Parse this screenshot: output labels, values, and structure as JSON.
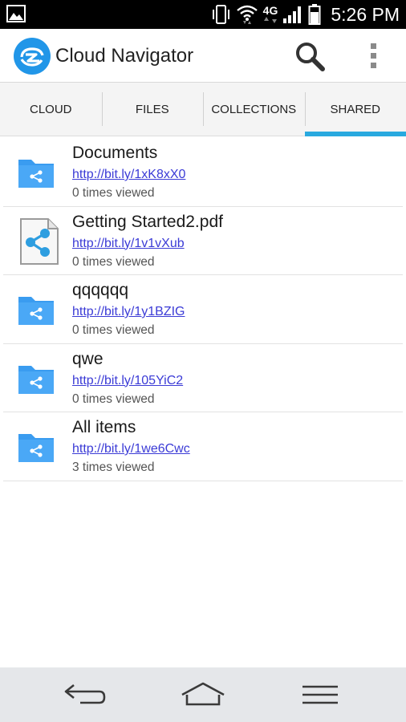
{
  "status_bar": {
    "time": "5:26 PM",
    "network": "4G",
    "icons": [
      "gallery-icon",
      "vibrate-icon",
      "wifi-icon",
      "lte-icon",
      "signal-icon",
      "battery-icon"
    ]
  },
  "app_bar": {
    "title": "Cloud Navigator",
    "logo": "cloud-navigator-logo",
    "actions": [
      "search-icon",
      "overflow-menu-icon"
    ]
  },
  "tabs": [
    {
      "label": "CLOUD",
      "active": false
    },
    {
      "label": "FILES",
      "active": false
    },
    {
      "label": "COLLECTIONS",
      "active": false
    },
    {
      "label": "SHARED",
      "active": true
    }
  ],
  "shared_items": [
    {
      "name": "Documents",
      "link": "http://bit.ly/1xK8xX0",
      "views": "0 times viewed",
      "icon": "shared-folder-icon"
    },
    {
      "name": "Getting Started2.pdf",
      "link": "http://bit.ly/1v1vXub",
      "views": "0 times viewed",
      "icon": "shared-file-icon"
    },
    {
      "name": "qqqqqq",
      "link": "http://bit.ly/1y1BZIG",
      "views": "0 times viewed",
      "icon": "shared-folder-icon"
    },
    {
      "name": "qwe",
      "link": "http://bit.ly/105YiC2",
      "views": "0 times viewed",
      "icon": "shared-folder-icon"
    },
    {
      "name": "All items",
      "link": "http://bit.ly/1we6Cwc",
      "views": "3 times viewed",
      "icon": "shared-folder-icon"
    }
  ],
  "nav_bar": [
    "back-icon",
    "home-icon",
    "menu-icon"
  ],
  "colors": {
    "accent": "#29a9df",
    "folder": "#3a9cf0",
    "logo": "#2196e8",
    "link": "#3b3bd6"
  }
}
